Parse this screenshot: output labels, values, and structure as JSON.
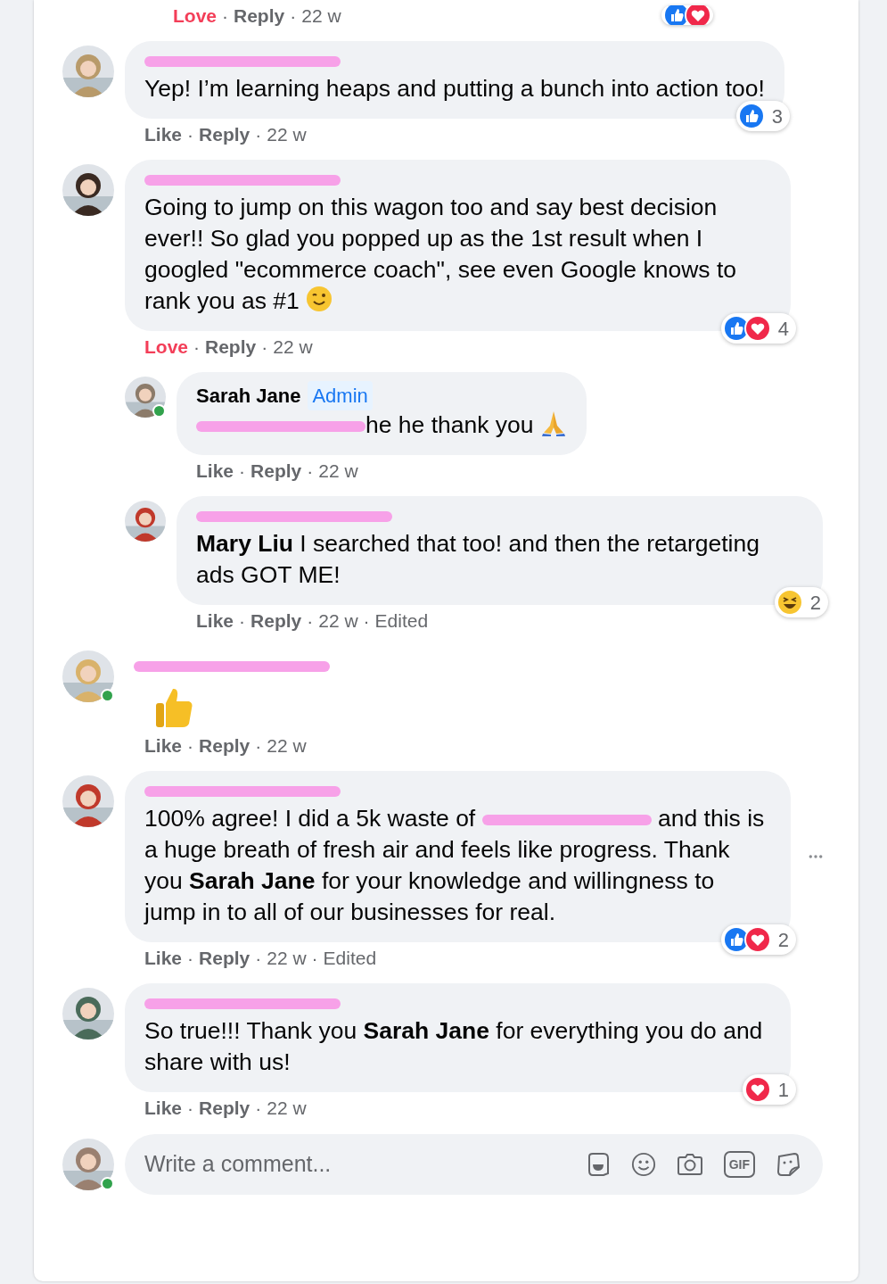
{
  "top_meta": {
    "items": [
      {
        "kind": "reaction",
        "text": "Love",
        "reacted": true
      },
      {
        "kind": "separator",
        "text": "·"
      },
      {
        "kind": "reply",
        "text": "Reply"
      },
      {
        "kind": "separator",
        "text": "·"
      },
      {
        "kind": "time",
        "text": "22 w"
      }
    ],
    "reactions": [
      {
        "kind": "like"
      },
      {
        "kind": "love"
      }
    ]
  },
  "comments": [
    {
      "kind": "bubble",
      "body": [
        {
          "kind": "text",
          "text": "Yep! I’m learning heaps and putting a bunch into action too!"
        }
      ],
      "reactions": {
        "types": [
          {
            "kind": "like"
          }
        ],
        "count": "3"
      },
      "meta": [
        {
          "kind": "reaction",
          "text": "Like",
          "reacted": false
        },
        {
          "kind": "separator",
          "text": "·"
        },
        {
          "kind": "reply",
          "text": "Reply"
        },
        {
          "kind": "separator",
          "text": "·"
        },
        {
          "kind": "time",
          "text": "22 w"
        }
      ]
    },
    {
      "kind": "bubble",
      "body": [
        {
          "kind": "text",
          "text": "Going to jump on this wagon too and say best decision ever!! So glad you popped up as the 1st result when I googled \"ecommerce coach\", see even Google knows to rank you as #1 "
        },
        {
          "kind": "wink"
        }
      ],
      "reactions": {
        "types": [
          {
            "kind": "like"
          },
          {
            "kind": "love"
          }
        ],
        "count": "4"
      },
      "meta": [
        {
          "kind": "reaction",
          "text": "Love",
          "reacted": true
        },
        {
          "kind": "separator",
          "text": "·"
        },
        {
          "kind": "reply",
          "text": "Reply"
        },
        {
          "kind": "separator",
          "text": "·"
        },
        {
          "kind": "time",
          "text": "22 w"
        }
      ],
      "replies": [
        {
          "online": true,
          "author": {
            "name": "Sarah Jane",
            "badge": "Admin"
          },
          "kind": "bubble",
          "body": [
            {
              "kind": "redacted"
            },
            {
              "kind": "text",
              "text": "he he thank you "
            },
            {
              "kind": "pray"
            }
          ],
          "meta": [
            {
              "kind": "reaction",
              "text": "Like",
              "reacted": false
            },
            {
              "kind": "separator",
              "text": "·"
            },
            {
              "kind": "reply",
              "text": "Reply"
            },
            {
              "kind": "separator",
              "text": "·"
            },
            {
              "kind": "time",
              "text": "22 w"
            }
          ]
        },
        {
          "kind": "bubble",
          "body": [
            {
              "kind": "mention",
              "text": "Mary Liu"
            },
            {
              "kind": "text",
              "text": " I searched that too! and then the retargeting ads GOT ME!"
            }
          ],
          "reactions": {
            "types": [
              {
                "kind": "haha"
              }
            ],
            "count": "2"
          },
          "meta": [
            {
              "kind": "reaction",
              "text": "Like",
              "reacted": false
            },
            {
              "kind": "separator",
              "text": "·"
            },
            {
              "kind": "reply",
              "text": "Reply"
            },
            {
              "kind": "separator",
              "text": "·"
            },
            {
              "kind": "time",
              "text": "22 w"
            },
            {
              "kind": "separator",
              "text": "·"
            },
            {
              "kind": "edited",
              "text": "Edited"
            }
          ]
        }
      ]
    },
    {
      "online": true,
      "kind": "sticker",
      "body": [
        {
          "kind": "thumbs"
        }
      ],
      "meta": [
        {
          "kind": "reaction",
          "text": "Like",
          "reacted": false
        },
        {
          "kind": "separator",
          "text": "·"
        },
        {
          "kind": "reply",
          "text": "Reply"
        },
        {
          "kind": "separator",
          "text": "·"
        },
        {
          "kind": "time",
          "text": "22 w"
        }
      ]
    },
    {
      "kind": "bubble",
      "body": [
        {
          "kind": "text",
          "text": "100% agree! I did a 5k waste of "
        },
        {
          "kind": "redacted"
        },
        {
          "kind": "text",
          "text": " and this is a huge breath of fresh air and feels like progress. Thank you "
        },
        {
          "kind": "mention",
          "text": "Sarah Jane"
        },
        {
          "kind": "text",
          "text": " for your knowledge and willingness to jump in to all of our businesses for real."
        }
      ],
      "reactions": {
        "types": [
          {
            "kind": "like"
          },
          {
            "kind": "love"
          }
        ],
        "count": "2"
      },
      "more": true,
      "meta": [
        {
          "kind": "reaction",
          "text": "Like",
          "reacted": false
        },
        {
          "kind": "separator",
          "text": "·"
        },
        {
          "kind": "reply",
          "text": "Reply"
        },
        {
          "kind": "separator",
          "text": "·"
        },
        {
          "kind": "time",
          "text": "22 w"
        },
        {
          "kind": "separator",
          "text": "·"
        },
        {
          "kind": "edited",
          "text": "Edited"
        }
      ]
    },
    {
      "kind": "bubble",
      "body": [
        {
          "kind": "text",
          "text": "So true!!! Thank you "
        },
        {
          "kind": "mention",
          "text": "Sarah Jane"
        },
        {
          "kind": "text",
          "text": " for everything you do and share with us!"
        }
      ],
      "reactions": {
        "types": [
          {
            "kind": "love"
          }
        ],
        "count": "1"
      },
      "meta": [
        {
          "kind": "reaction",
          "text": "Like",
          "reacted": false
        },
        {
          "kind": "separator",
          "text": "·"
        },
        {
          "kind": "reply",
          "text": "Reply"
        },
        {
          "kind": "separator",
          "text": "·"
        },
        {
          "kind": "time",
          "text": "22 w"
        }
      ]
    }
  ],
  "composer": {
    "online": true,
    "placeholder": "Write a comment...",
    "gif_label": "GIF"
  }
}
